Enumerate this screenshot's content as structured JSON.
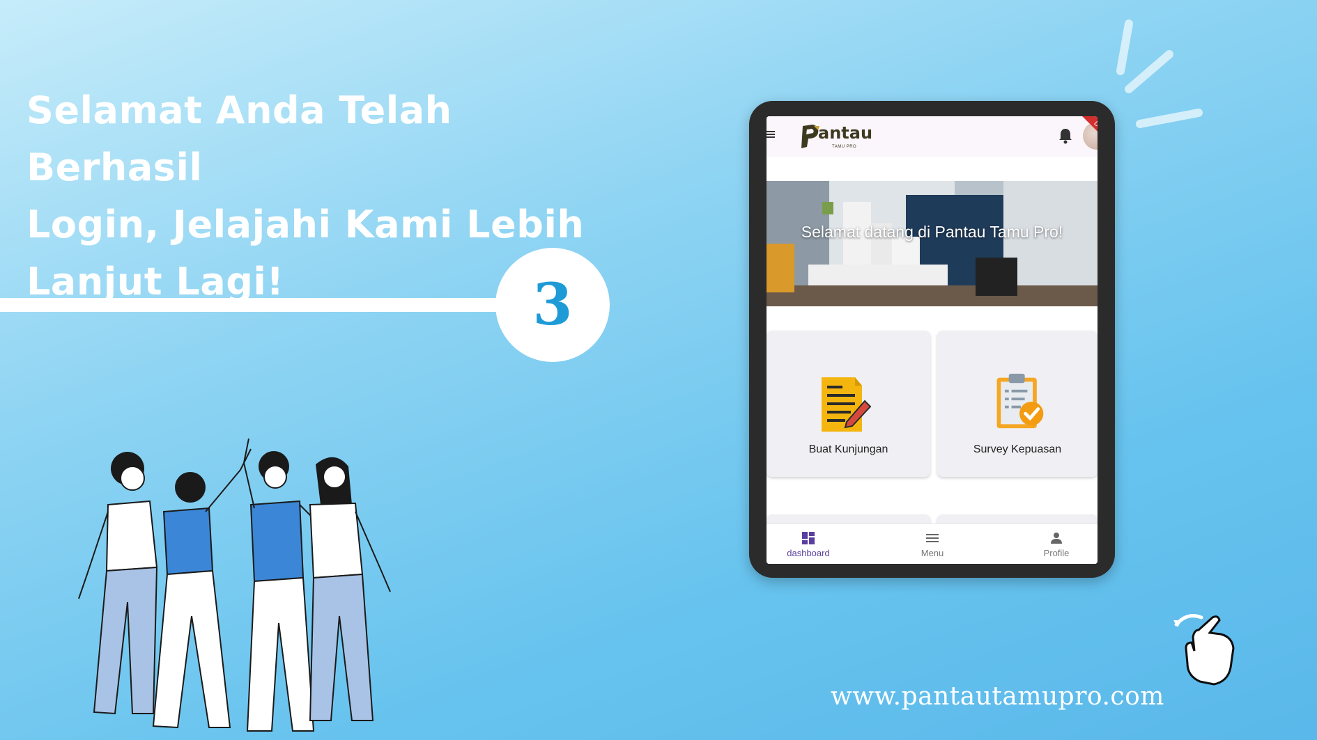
{
  "headline": {
    "line1": "Selamat Anda Telah Berhasil",
    "line2": "Login, Jelajahi Kami Lebih",
    "line3": "Lanjut Lagi!"
  },
  "step_number": "3",
  "website": "www.pantautamupro.com",
  "colors": {
    "accent": "#1e9bd7",
    "nav_active": "#5b3f9e",
    "background_top": "#c6ecfa",
    "background_bottom": "#5ab8ea"
  },
  "app": {
    "logo_text": "antau",
    "logo_subtitle": "TAMU PRO",
    "ribbon": "DE",
    "hero_text": "Selamat datang di Pantau Tamu Pro!",
    "cards": [
      {
        "label": "Buat Kunjungan",
        "icon": "document-edit-icon"
      },
      {
        "label": "Survey Kepuasan",
        "icon": "clipboard-check-icon"
      }
    ],
    "nav": [
      {
        "label": "dashboard",
        "icon": "dashboard-icon",
        "active": true
      },
      {
        "label": "Menu",
        "icon": "menu-icon",
        "active": false
      },
      {
        "label": "Profile",
        "icon": "person-icon",
        "active": false
      }
    ]
  }
}
